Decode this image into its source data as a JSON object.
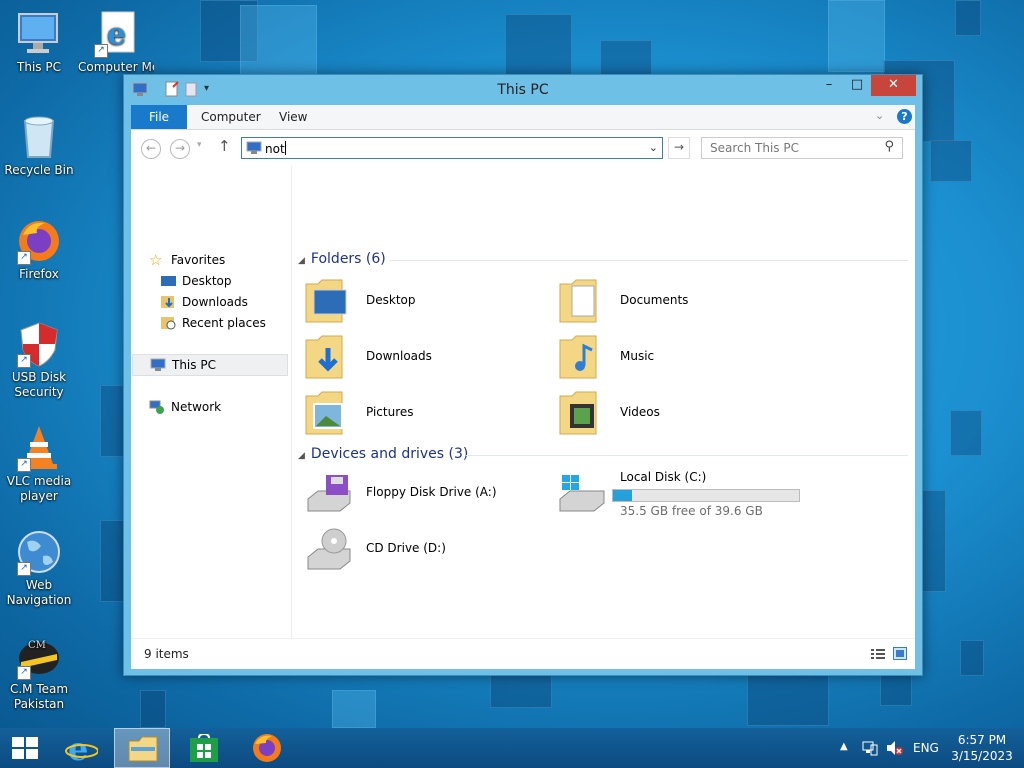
{
  "desktop": {
    "icons": [
      {
        "name": "this-pc",
        "label": "This PC"
      },
      {
        "name": "computer-media",
        "label": "Computer Med"
      },
      {
        "name": "recycle-bin",
        "label": "Recycle Bin"
      },
      {
        "name": "firefox",
        "label": "Firefox"
      },
      {
        "name": "usb-disk-security",
        "label": "USB Disk Security"
      },
      {
        "name": "vlc",
        "label": "VLC media player"
      },
      {
        "name": "web-navigation",
        "label": "Web Navigation"
      },
      {
        "name": "cm-team",
        "label": "C.M Team Pakistan"
      }
    ]
  },
  "window": {
    "title": "This PC",
    "min_label": "–",
    "max_label": "□",
    "close_label": "✕"
  },
  "ribbon": {
    "tabs": [
      "File",
      "Computer",
      "View"
    ],
    "help_label": "?"
  },
  "address": {
    "value": "not",
    "search_placeholder": "Search This PC"
  },
  "nav": {
    "favorites": "Favorites",
    "desktop": "Desktop",
    "downloads": "Downloads",
    "recent": "Recent places",
    "this_pc": "This PC",
    "network": "Network"
  },
  "folders": {
    "header": "Folders (6)",
    "items": [
      "Desktop",
      "Documents",
      "Downloads",
      "Music",
      "Pictures",
      "Videos"
    ]
  },
  "drives": {
    "header": "Devices and drives (3)",
    "floppy": "Floppy Disk Drive (A:)",
    "local": "Local Disk (C:)",
    "local_free": "35.5 GB free of 39.6 GB",
    "local_used_fraction": 0.104,
    "cd": "CD Drive (D:)"
  },
  "status": {
    "items": "9 items"
  },
  "taskbar": {
    "lang": "ENG",
    "time": "6:57 PM",
    "date": "3/15/2023"
  },
  "colors": {
    "accent": "#1979ca",
    "close": "#c7453a",
    "drive_bar": "#26a0da",
    "group_header": "#1e3287"
  }
}
